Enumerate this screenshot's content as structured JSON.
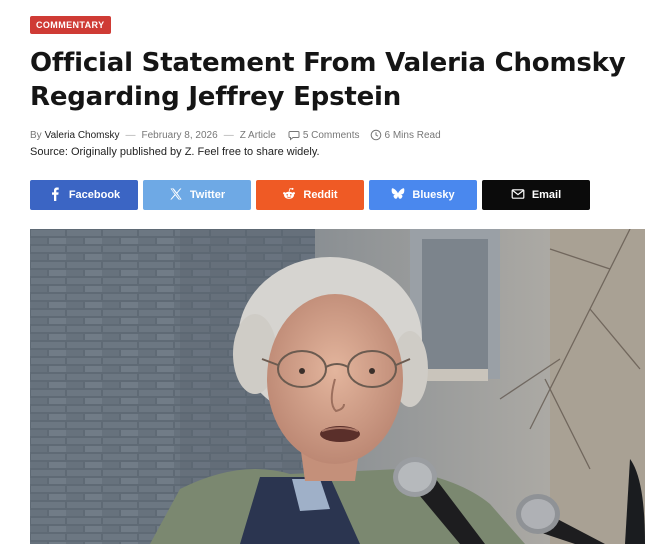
{
  "article": {
    "category": "COMMENTARY",
    "title": "Official Statement From Valeria Chomsky Regarding Jeffrey Epstein",
    "meta": {
      "by_label": "By",
      "author": "Valeria Chomsky",
      "date": "February 8, 2026",
      "section": "Z Article",
      "comments": "5 Comments",
      "read_time": "6 Mins Read",
      "comment_icon": "speech-bubble-icon",
      "clock_icon": "clock-icon"
    },
    "source_line": "Source: Originally published by Z. Feel free to share widely."
  },
  "share": {
    "buttons": [
      {
        "label": "Facebook",
        "icon": "facebook-icon",
        "color": "#3b65c4"
      },
      {
        "label": "Twitter",
        "icon": "x-icon",
        "color": "#6ea9e5"
      },
      {
        "label": "Reddit",
        "icon": "reddit-icon",
        "color": "#ef5a25"
      },
      {
        "label": "Bluesky",
        "icon": "butterfly-icon",
        "color": "#4a88ee"
      },
      {
        "label": "Email",
        "icon": "envelope-icon",
        "color": "#0b0b0b"
      }
    ]
  },
  "colors": {
    "badge": "#cf3b35",
    "text": "#151515",
    "meta": "#777777"
  }
}
